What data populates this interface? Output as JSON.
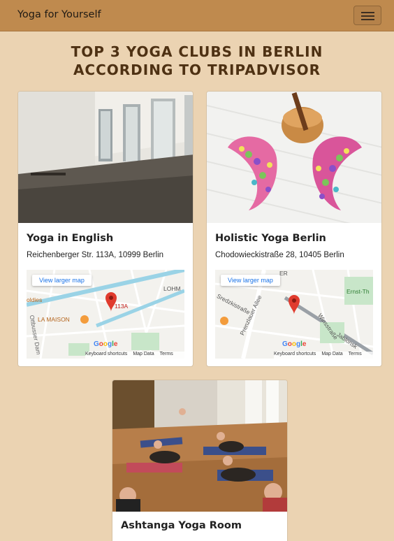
{
  "navbar": {
    "brand": "Yoga for Yourself"
  },
  "page": {
    "title": "TOP 3 YOGA CLUBS IN BERLIN ACCORDING TO TRIPADVISOR"
  },
  "map_common": {
    "view_larger": "View larger map",
    "keyboard_shortcuts": "Keyboard shortcuts",
    "map_data": "Map Data",
    "terms": "Terms"
  },
  "clubs": [
    {
      "name": "Yoga in English",
      "address": "Reichenberger Str. 113A, 10999 Berlin",
      "map_labels": {
        "street": "LOHM",
        "area": "oldies",
        "place": "LA MAISON",
        "marker": "113A",
        "road": "Ottbusser Dam"
      }
    },
    {
      "name": "Holistic Yoga Berlin",
      "address": "Chodowieckistraße 28, 10405 Berlin",
      "map_labels": {
        "top": "ER",
        "poi": "Ernst-Th",
        "street1": "Sredzkistraße",
        "street2": "Prenzlauer Allee",
        "street3": "Winsstraße",
        "street4": "Jablonsk"
      }
    },
    {
      "name": "Ashtanga Yoga Room"
    }
  ]
}
